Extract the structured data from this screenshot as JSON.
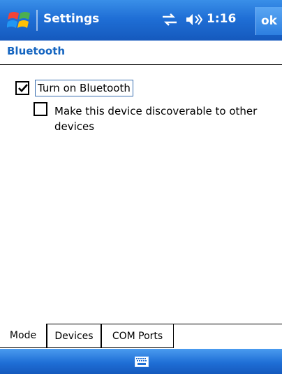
{
  "titlebar": {
    "app_title": "Settings",
    "clock": "1:16",
    "ok_label": "ok",
    "icons": [
      "start-flag-icon",
      "connectivity-icon",
      "volume-icon"
    ]
  },
  "page": {
    "heading": "Bluetooth",
    "options": [
      {
        "label": "Turn on Bluetooth",
        "checked": true
      },
      {
        "label": "Make this device discoverable to other devices",
        "checked": false
      }
    ]
  },
  "tabs": [
    {
      "label": "Mode",
      "active": true
    },
    {
      "label": "Devices",
      "active": false
    },
    {
      "label": "COM Ports",
      "active": false
    }
  ],
  "bottombar": {
    "icons": [
      "keyboard-icon"
    ]
  },
  "colors": {
    "titlebar_blue": "#1f6fd6",
    "heading_blue": "#1565c0"
  }
}
